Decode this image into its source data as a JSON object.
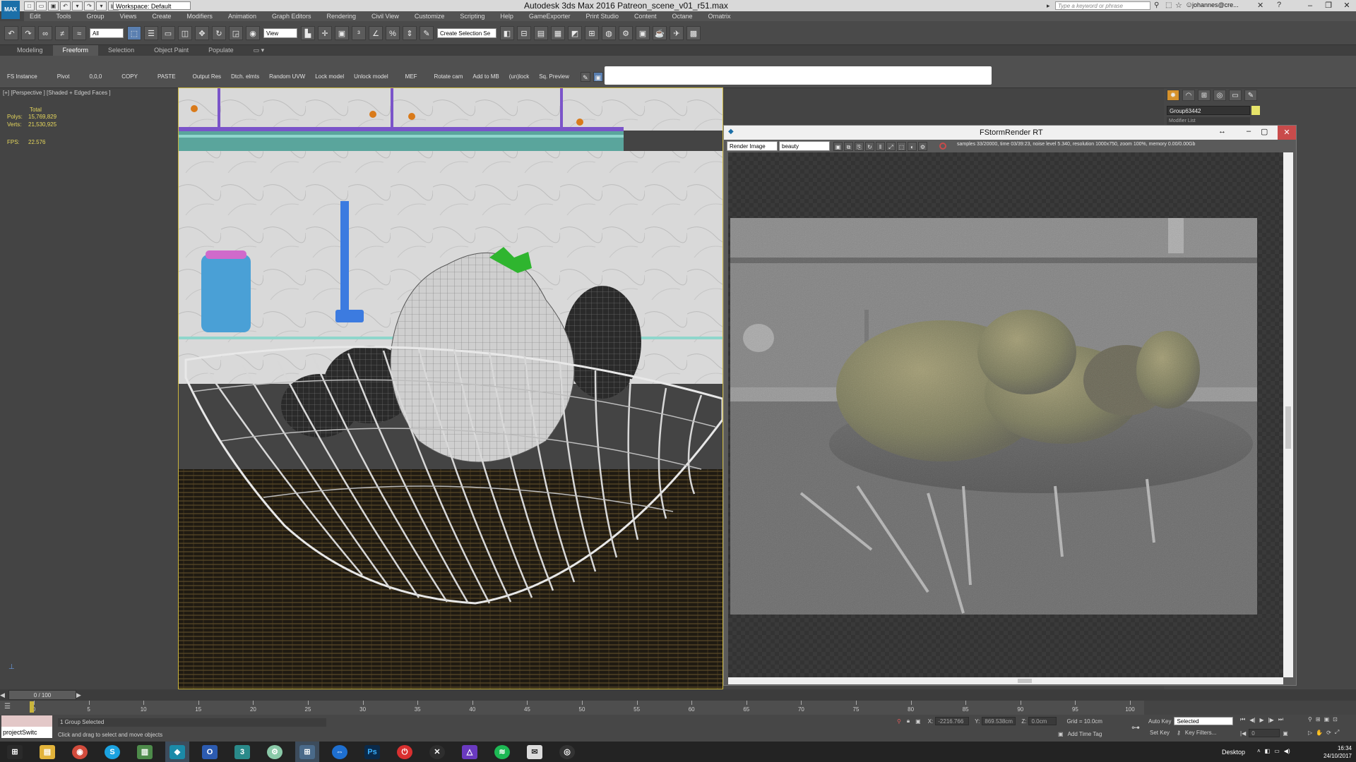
{
  "titlebar": {
    "app_icon": "MAX",
    "workspace": "Workspace: Default",
    "title": "Autodesk 3ds Max 2016     Patreon_scene_v01_r51.max",
    "search_placeholder": "Type a keyword or phrase",
    "user": "johannes@cre...",
    "window_buttons": [
      "–",
      "❐",
      "✕"
    ]
  },
  "menus": [
    "Edit",
    "Tools",
    "Group",
    "Views",
    "Create",
    "Modifiers",
    "Animation",
    "Graph Editors",
    "Rendering",
    "Civil View",
    "Customize",
    "Scripting",
    "Help",
    "GameExporter",
    "Print Studio",
    "Content",
    "Octane",
    "Ornatrix"
  ],
  "main_toolbar": {
    "selection_filter": "All",
    "reference_coord": "View",
    "named_selection": "Create Selection Se"
  },
  "ribbon_tabs": [
    "Modeling",
    "Freeform",
    "Selection",
    "Object Paint",
    "Populate"
  ],
  "ribbon_buttons": [
    "FS Instance",
    "Pivot",
    "0,0,0",
    "COPY",
    "PASTE",
    "Output Res",
    "Dtch. elmts",
    "Random UVW",
    "Lock model",
    "Unlock model",
    "MEF",
    "Rotate cam",
    "Add to MB",
    "(un)lock",
    "Sq. Preview"
  ],
  "viewport": {
    "label": "[+] [Perspective ] [Shaded + Edged Faces ]",
    "stats_header": "Total",
    "polys_label": "Polys:",
    "polys": "15,769,829",
    "verts_label": "Verts:",
    "verts": "21,530,925",
    "fps_label": "FPS:",
    "fps": "22.576"
  },
  "render_window": {
    "title": "FStormRender RT",
    "channel": "Render Image",
    "element": "beauty",
    "status": "samples 33/20000,  time 03/39:23,  noise level 5.340,  resolution 1000x750,  zoom 100%,  memory 0.00/0.00Gb"
  },
  "command_panel": {
    "object_name": "Group63442",
    "modifier_list": "Modifier List"
  },
  "timeline": {
    "frame": "0 / 100",
    "ticks": [
      "0",
      "5",
      "10",
      "15",
      "20",
      "25",
      "30",
      "35",
      "40",
      "45",
      "50",
      "55",
      "60",
      "65",
      "70",
      "75",
      "80",
      "85",
      "90",
      "95",
      "100"
    ]
  },
  "statusbar": {
    "maxscript": "projectSwitc",
    "selection": "1 Group Selected",
    "prompt": "Click and drag to select and move objects",
    "x_label": "X:",
    "x": "-2216.766",
    "y_label": "Y:",
    "y": "869.538cm",
    "z_label": "Z:",
    "z": "0.0cm",
    "grid": "Grid = 10.0cm",
    "add_time_tag": "Add Time Tag",
    "auto_key": "Auto Key",
    "set_key": "Set Key",
    "selected": "Selected",
    "key_filters": "Key Filters...",
    "current_frame": "0"
  },
  "taskbar": {
    "apps": [
      "windows",
      "file-explorer",
      "chrome",
      "skype",
      "notepad",
      "3dsmax",
      "outlook",
      "app3",
      "gears",
      "network",
      "teamviewer",
      "photoshop",
      "power",
      "xbox",
      "affinity",
      "spotify",
      "mail",
      "obs"
    ],
    "desktop": "Desktop",
    "time": "16:34",
    "date": "24/10/2017"
  },
  "colors": {
    "viewport_sel_border": "#c9b43c",
    "accent_blue": "#5a7fb0",
    "close_red": "#c94b4b"
  }
}
